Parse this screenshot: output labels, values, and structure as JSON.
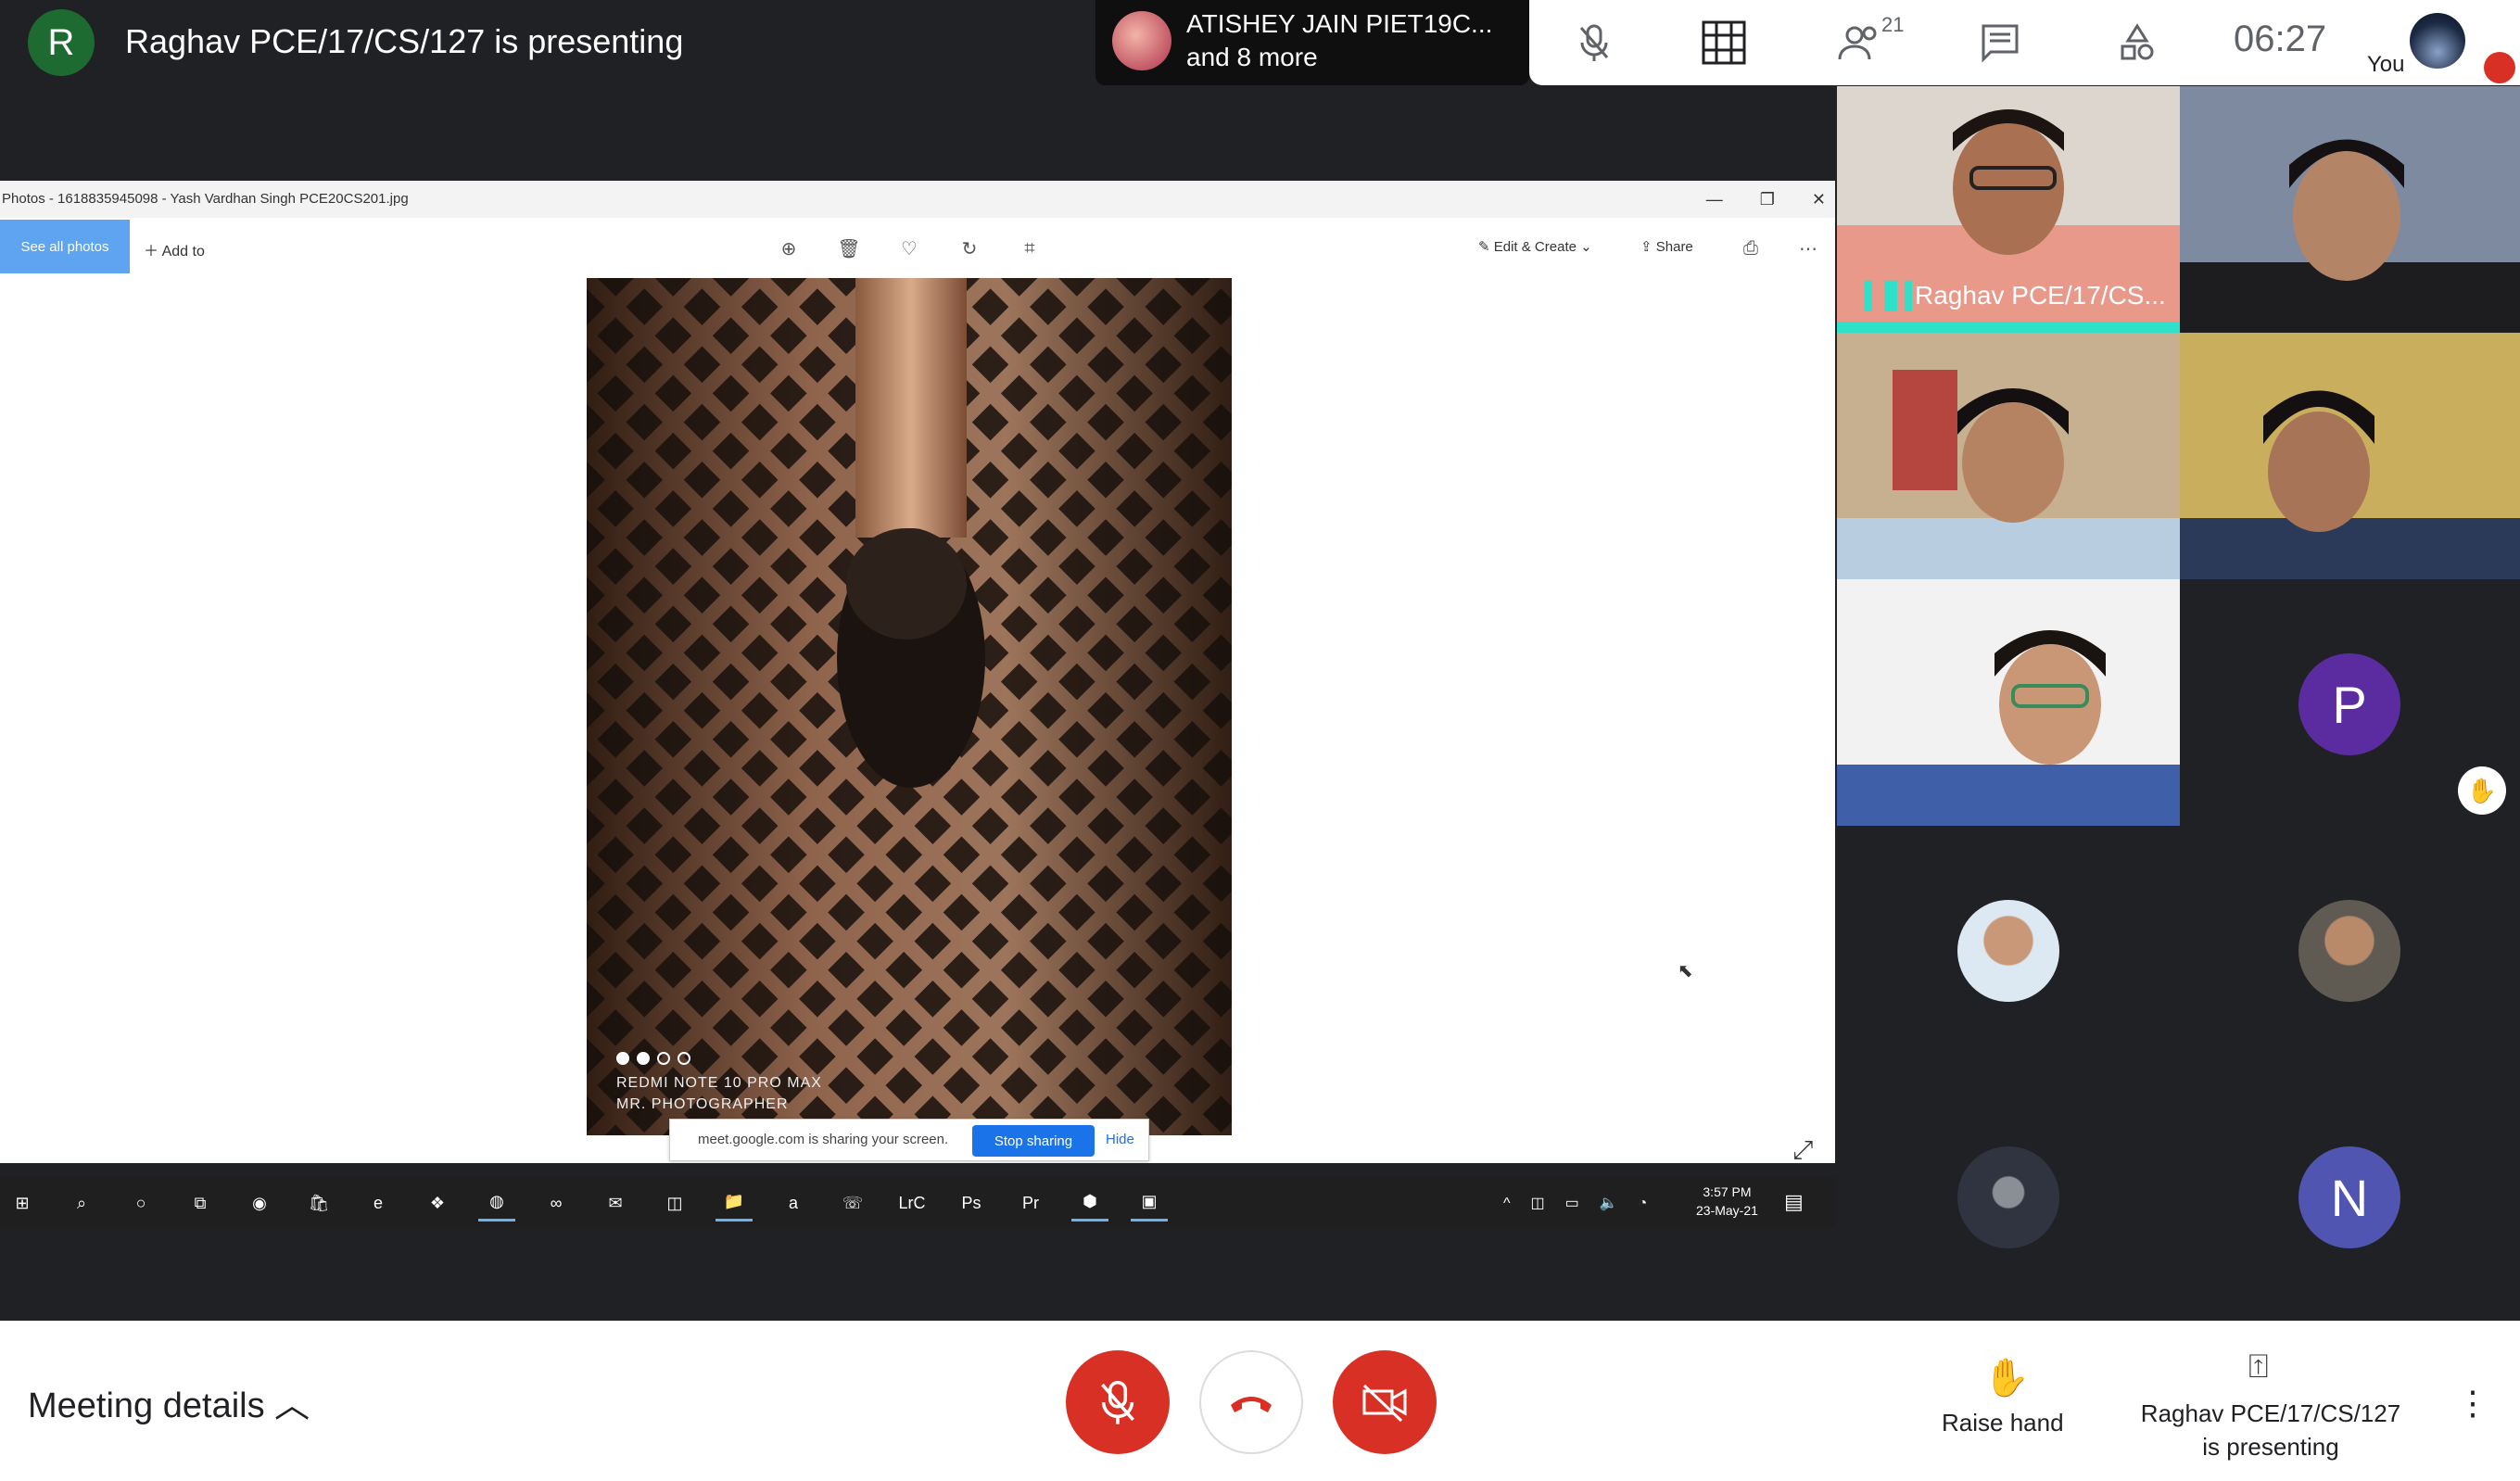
{
  "header": {
    "presenter_initial": "R",
    "presenting_title": "Raghav PCE/17/CS/127 is presenting",
    "chip_name": "ATISHEY JAIN PIET19C...",
    "chip_more": "and 8 more",
    "participant_count": "21",
    "clock": "06:27",
    "you_label": "You"
  },
  "shared_window": {
    "title": "Photos - 1618835945098 - Yash Vardhan Singh PCE20CS201.jpg",
    "see_all_photos": "See all photos",
    "add_to": "Add to",
    "edit_create": "Edit & Create",
    "share": "Share",
    "caption_line1": "REDMI NOTE 10 PRO MAX",
    "caption_line2": "MR. PHOTOGRAPHER",
    "sharing_text": "meet.google.com is sharing your screen.",
    "stop_sharing": "Stop sharing",
    "hide": "Hide",
    "taskbar_time": "3:57 PM",
    "taskbar_date": "23-May-21",
    "taskbar_apps": [
      "⊞",
      "⌕",
      "○",
      "⧉",
      "◉",
      "🛍",
      "e",
      "❖",
      "◍",
      "∞",
      "✉",
      "◫",
      "📁",
      "a",
      "☏",
      "LrC",
      "Ps",
      "Pr",
      "⬢",
      "▣"
    ]
  },
  "participants": {
    "speaker_name": "Raghav PCE/17/CS...",
    "avatar_p": "P",
    "avatar_n": "N",
    "colors": {
      "p": "#5b2ca0",
      "n": "#4f55b0",
      "speaking": "#2fe1c8"
    }
  },
  "bottom_bar": {
    "meeting_details": "Meeting details",
    "raise_hand": "Raise hand",
    "presenting_line1": "Raghav PCE/17/CS/127",
    "presenting_line2": "is presenting",
    "colors": {
      "danger": "#d93025"
    }
  }
}
